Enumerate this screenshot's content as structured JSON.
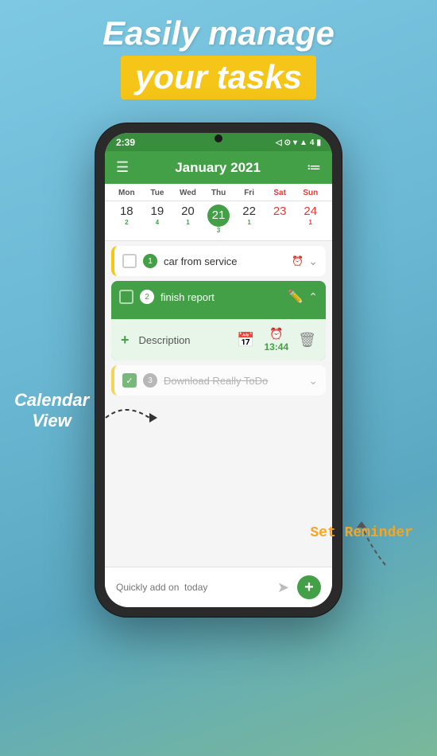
{
  "background": {
    "title1": "Easily manage",
    "title2": "your tasks"
  },
  "label_calendar_view": "Calendar\nView",
  "label_set_reminder": "Set Reminder",
  "phone": {
    "status_bar": {
      "time": "2:39",
      "icons": "▶ ⊙ ▾ ▲ 4 🔋"
    },
    "header": {
      "menu_icon": "☰",
      "title": "January 2021",
      "list_icon": "≔"
    },
    "days": [
      "Mon",
      "Tue",
      "Wed",
      "Thu",
      "Fri",
      "Sat",
      "Sun"
    ],
    "dates": [
      {
        "num": "18",
        "badge": "2",
        "today": false
      },
      {
        "num": "19",
        "badge": "4",
        "today": false
      },
      {
        "num": "20",
        "badge": "1",
        "today": false
      },
      {
        "num": "21",
        "badge": "3",
        "today": true
      },
      {
        "num": "22",
        "badge": "1",
        "today": false
      },
      {
        "num": "23",
        "badge": "",
        "today": false
      },
      {
        "num": "24",
        "badge": "1",
        "today": false
      }
    ],
    "tasks": [
      {
        "id": 1,
        "number": "1",
        "text": "car from service",
        "expanded": false,
        "completed": false,
        "has_alarm": true
      },
      {
        "id": 2,
        "number": "2",
        "text": "finish report",
        "expanded": true,
        "completed": false,
        "description": "Description",
        "reminder_time": "13:44"
      },
      {
        "id": 3,
        "number": "3",
        "text": "Download Really ToDo",
        "expanded": false,
        "completed": true
      }
    ],
    "bottom_bar": {
      "placeholder": "Quickly add on  today",
      "send_icon": "➤",
      "add_icon": "+"
    }
  }
}
